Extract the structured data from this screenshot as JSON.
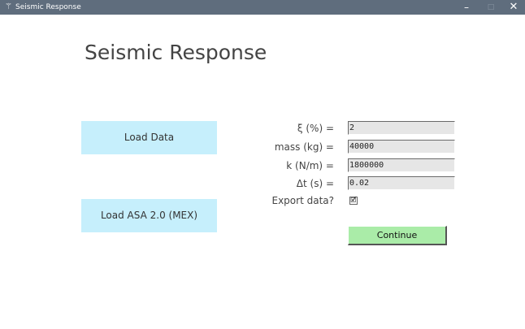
{
  "window": {
    "title": "Seismic Response",
    "icon": "feather-icon",
    "controls": {
      "minimize": "–",
      "maximize": "□",
      "close": "✕"
    }
  },
  "header": {
    "title": "Seismic Response"
  },
  "buttons": {
    "load_data": "Load Data",
    "load_asa": "Load ASA 2.0 (MEX)",
    "continue": "Continue"
  },
  "form": {
    "damping": {
      "label": "ξ (%) =",
      "value": "2"
    },
    "mass": {
      "label": "mass (kg) =",
      "value": "40000"
    },
    "stiffness": {
      "label": "k (N/m) =",
      "value": "1800000"
    },
    "dt": {
      "label": "Δt (s) =",
      "value": "0.02"
    },
    "export": {
      "label": "Export data?",
      "checked": true,
      "mark": "🗹"
    }
  },
  "colors": {
    "titlebar": "#5f6d7d",
    "load_button_bg": "#c6effc",
    "continue_bg": "#aaeca8",
    "field_bg": "#e6e6e6"
  }
}
